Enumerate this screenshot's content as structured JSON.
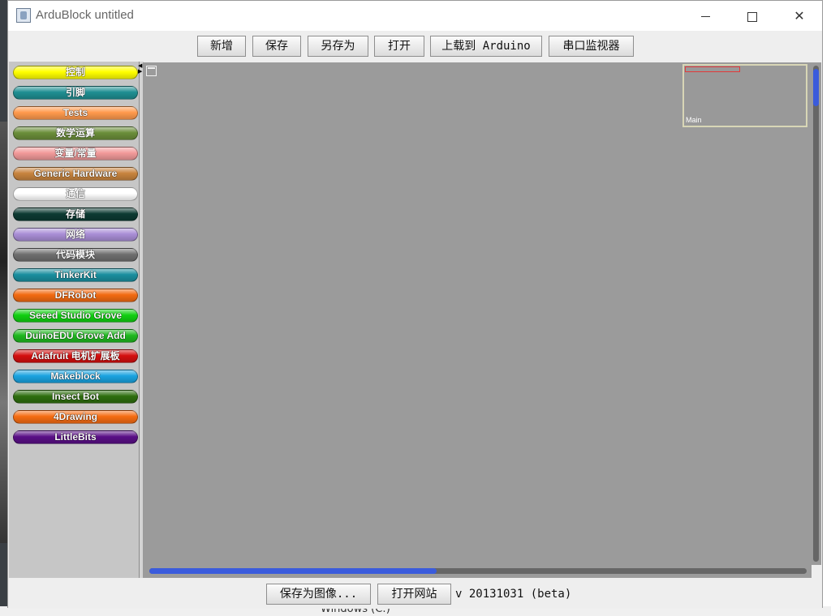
{
  "window": {
    "title": "ArduBlock untitled",
    "controls": {
      "minimize": "minimize-icon",
      "maximize": "maximize-icon",
      "close": "✕"
    }
  },
  "toolbar": {
    "buttons": [
      {
        "label": "新增"
      },
      {
        "label": "保存"
      },
      {
        "label": "另存为"
      },
      {
        "label": "打开"
      },
      {
        "label": "上载到 Arduino"
      },
      {
        "label": "串口监视器"
      }
    ]
  },
  "palette": {
    "drawers": [
      {
        "label": "控制",
        "color": "#ffff00"
      },
      {
        "label": "引脚",
        "color": "#1f8f92"
      },
      {
        "label": "Tests",
        "color": "#ff9a4d"
      },
      {
        "label": "数学运算",
        "color": "#6b8e3a"
      },
      {
        "label": "变量/常量",
        "color": "#f29a9a"
      },
      {
        "label": "Generic Hardware",
        "color": "#c8843e"
      },
      {
        "label": "通信",
        "color": "#ffffff"
      },
      {
        "label": "存储",
        "color": "#0c3a32"
      },
      {
        "label": "网络",
        "color": "#a98ed6"
      },
      {
        "label": "代码模块",
        "color": "#6f6f6f"
      },
      {
        "label": "TinkerKit",
        "color": "#1a8f9f"
      },
      {
        "label": "DFRobot",
        "color": "#f26a12"
      },
      {
        "label": "Seeed Studio Grove",
        "color": "#11d011"
      },
      {
        "label": "DuinoEDU Grove Add",
        "color": "#1fb81f"
      },
      {
        "label": "Adafruit 电机扩展板",
        "color": "#d40f0f"
      },
      {
        "label": "Makeblock",
        "color": "#1aa3e0"
      },
      {
        "label": "Insect Bot",
        "color": "#2e6e0e"
      },
      {
        "label": "4Drawing",
        "color": "#f56c12"
      },
      {
        "label": "LittleBits",
        "color": "#5a0f86"
      }
    ]
  },
  "canvas": {
    "minimap_label": "Main",
    "background_color": "#9b9b9b"
  },
  "scrollbars": {
    "accent": "#3a5bdc"
  },
  "statusbar": {
    "save_image_label": "保存为图像...",
    "open_site_label": "打开网站",
    "version": "v 20131031 (beta)"
  },
  "background": {
    "drive_label": "Windows (C:)"
  }
}
